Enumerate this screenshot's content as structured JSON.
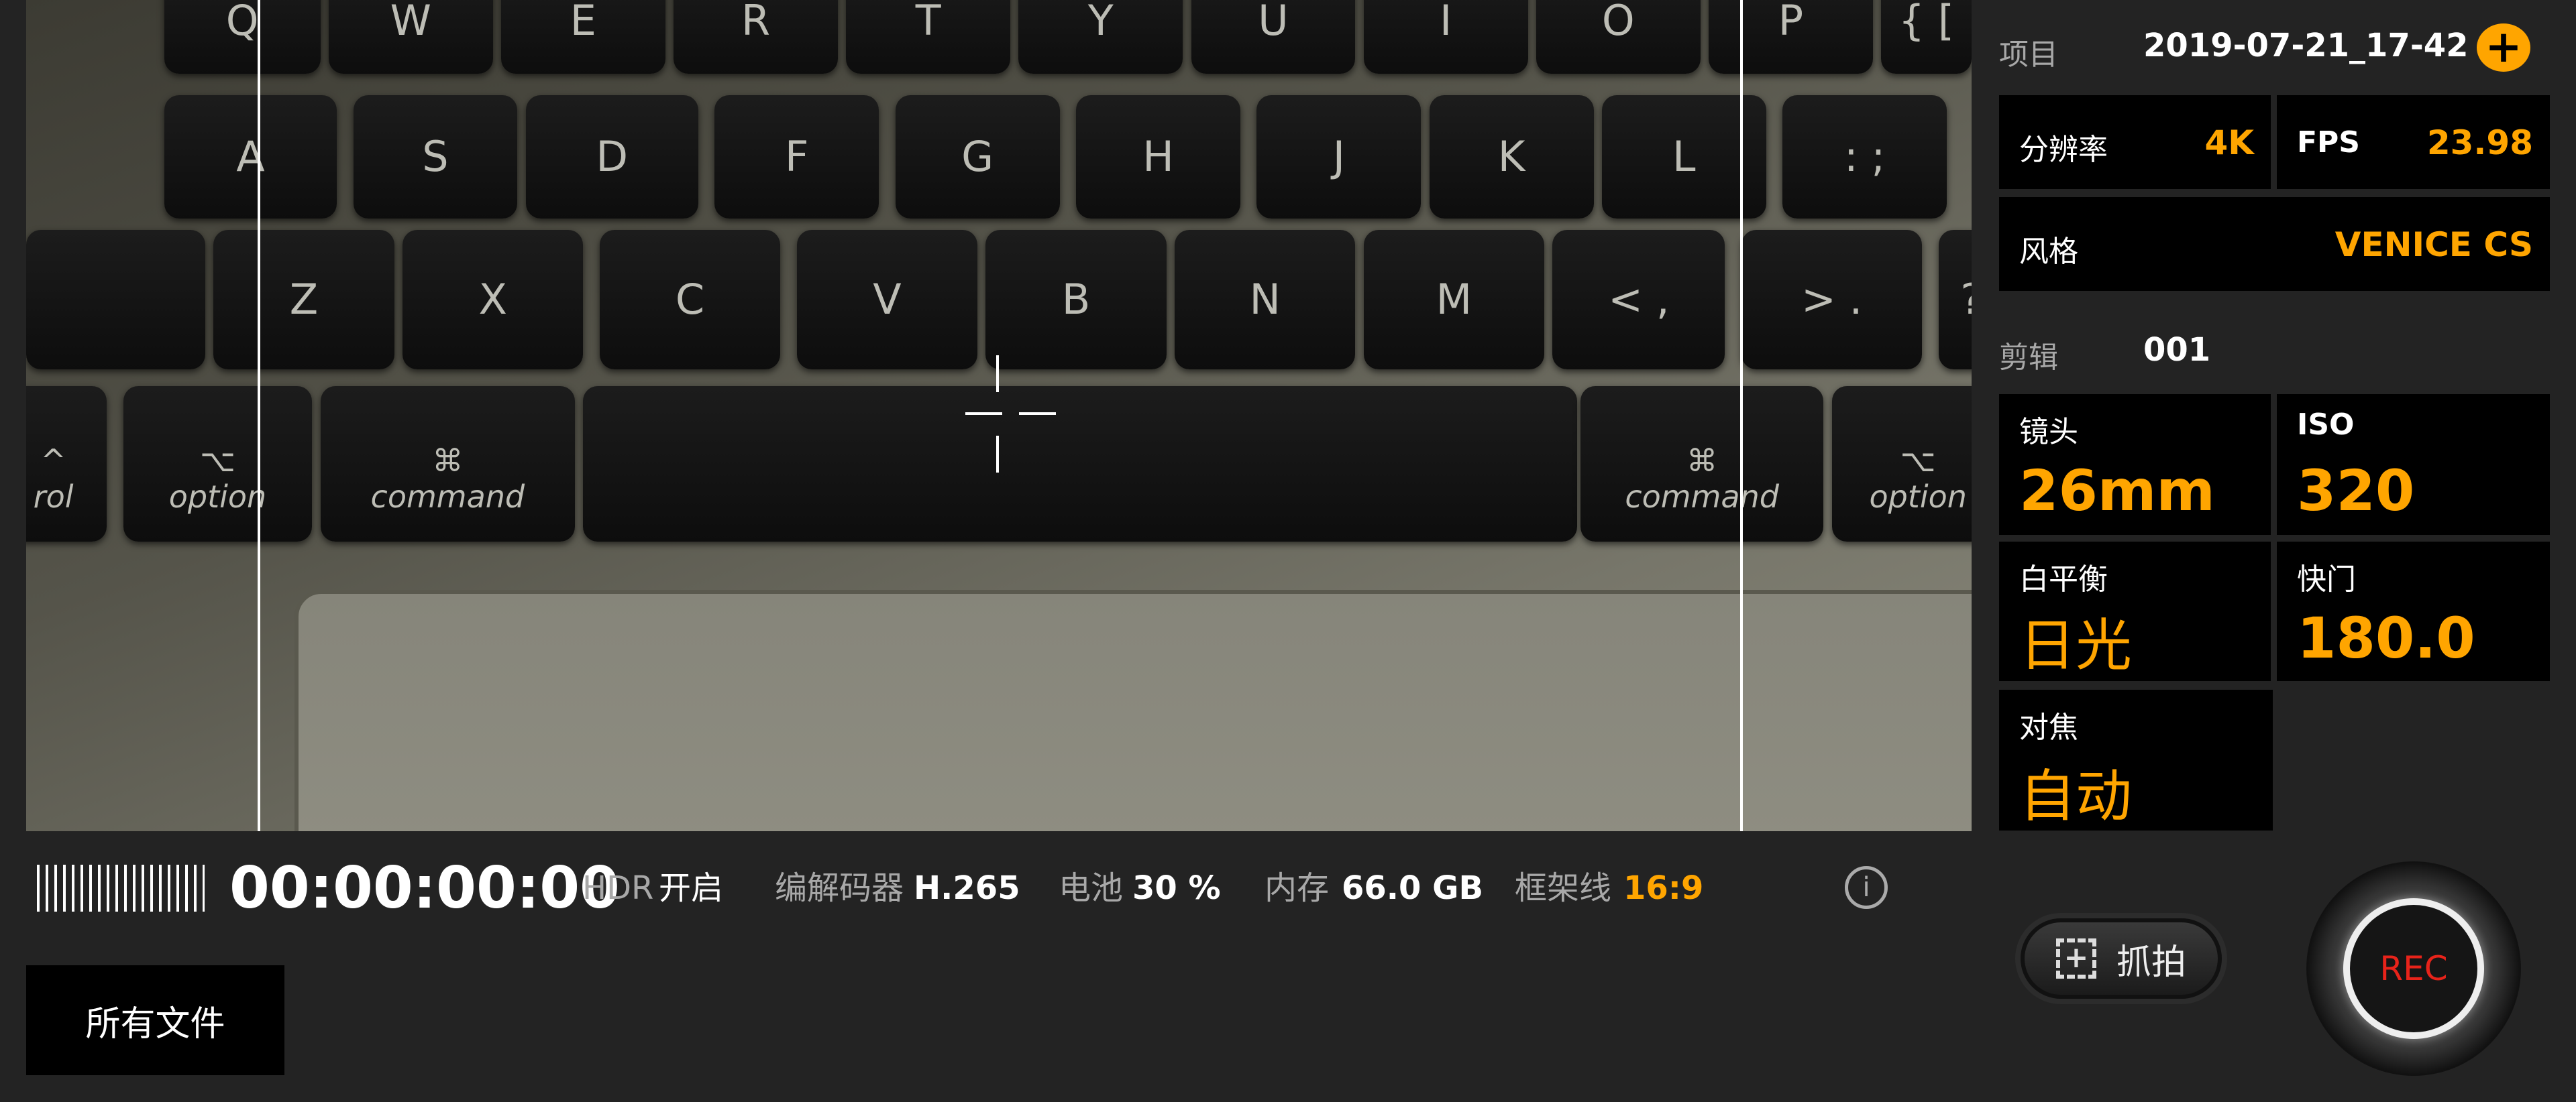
{
  "viewfinder": {
    "keys_row1": [
      "Q",
      "W",
      "E",
      "R",
      "T",
      "Y",
      "U",
      "I",
      "O",
      "P",
      "{ ["
    ],
    "keys_row2": [
      "A",
      "S",
      "D",
      "F",
      "G",
      "H",
      "J",
      "K",
      "L",
      ": ;"
    ],
    "keys_row3": [
      "",
      "Z",
      "X",
      "C",
      "V",
      "B",
      "N",
      "M",
      "< ,",
      "> .",
      "?"
    ],
    "keys_row4": [
      {
        "sym": "^",
        "label": "rol"
      },
      {
        "sym": "⌥",
        "label": "option"
      },
      {
        "sym": "⌘",
        "label": "command"
      },
      {
        "sym": "",
        "label": ""
      },
      {
        "sym": "⌘",
        "label": "command"
      },
      {
        "sym": "⌥",
        "label": "option"
      }
    ],
    "frame_lines": "16:9"
  },
  "status": {
    "timecode": "00:00:00:00",
    "hdr_label": "HDR",
    "hdr_value": "开启",
    "codec_label": "编解码器",
    "codec_value": "H.265",
    "battery_label": "电池",
    "battery_value": "30 %",
    "storage_label": "内存",
    "storage_value": "66.0 GB",
    "frameline_label": "框架线",
    "frameline_value": "16:9",
    "info_icon": "info-icon"
  },
  "all_files_label": "所有文件",
  "panel": {
    "project_label": "项目",
    "project_value": "2019-07-21_17-42",
    "resolution_label": "分辨率",
    "resolution_value": "4K",
    "fps_label": "FPS",
    "fps_value": "23.98",
    "style_label": "风格",
    "style_value": "VENICE CS",
    "clip_label": "剪辑",
    "clip_value": "001",
    "lens_label": "镜头",
    "lens_value": "26mm",
    "iso_label": "ISO",
    "iso_value": "320",
    "wb_label": "白平衡",
    "wb_value": "日光",
    "shutter_label": "快门",
    "shutter_value": "180.0",
    "focus_label": "对焦",
    "focus_value": "自动",
    "snapshot_label": "抓拍",
    "rec_label": "REC"
  },
  "colors": {
    "accent": "#ffa500",
    "rec": "#e8231a",
    "background": "#232323"
  }
}
